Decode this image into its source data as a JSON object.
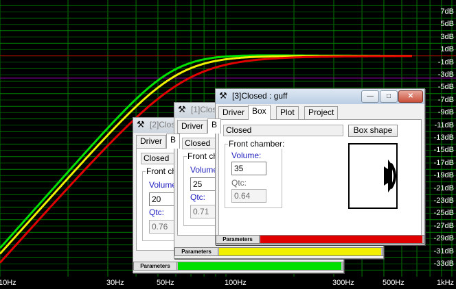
{
  "graph": {
    "y_labels": [
      "7dB",
      "5dB",
      "3dB",
      "1dB",
      "-1dB",
      "-3dB",
      "-5dB",
      "-7dB",
      "-9dB",
      "-11dB",
      "-13dB",
      "-15dB",
      "-17dB",
      "-19dB",
      "-21dB",
      "-23dB",
      "-25dB",
      "-27dB",
      "-29dB",
      "-31dB",
      "-33dB"
    ],
    "x_labels": [
      "10Hz",
      "30Hz",
      "50Hz",
      "100Hz",
      "300Hz",
      "500Hz",
      "1kHz"
    ],
    "grid_color": "#007a00",
    "reference_line_color": "#cc0000",
    "curves": [
      {
        "id": "green",
        "color": "#00e000"
      },
      {
        "id": "yellow",
        "color": "#f0f000"
      },
      {
        "id": "red",
        "color": "#e00000"
      }
    ]
  },
  "windows": {
    "w1": {
      "title": "[2]Clos",
      "tabs": [
        "Driver",
        "B"
      ],
      "box_type": "Closed",
      "group_label": "Front cha",
      "volume_label": "Volume:",
      "volume_value": "20",
      "qtc_label": "Qtc:",
      "qtc_value": "0.76",
      "params_label": "Parameters",
      "color": "#00e000"
    },
    "w2": {
      "title": "[1]Clos",
      "tabs": [
        "Driver",
        "B"
      ],
      "box_type": "Closed",
      "group_label": "Front cha",
      "volume_label": "Volume:",
      "volume_value": "25",
      "qtc_label": "Qtc:",
      "qtc_value": "0.71",
      "params_label": "Parameters",
      "color": "#f0f000"
    },
    "w3": {
      "title": "[3]Closed : guff",
      "tabs": [
        "Driver",
        "Box",
        "Plot",
        "Project"
      ],
      "selected_tab": "Box",
      "box_type": "Closed",
      "box_shape_button": "Box shape",
      "group_label": "Front chamber:",
      "volume_label": "Volume:",
      "volume_value": "35",
      "qtc_label": "Qtc:",
      "qtc_value": "0.64",
      "params_label": "Parameters",
      "color": "#e00000",
      "min_symbol": "—",
      "max_symbol": "□",
      "close_symbol": "✕"
    }
  }
}
